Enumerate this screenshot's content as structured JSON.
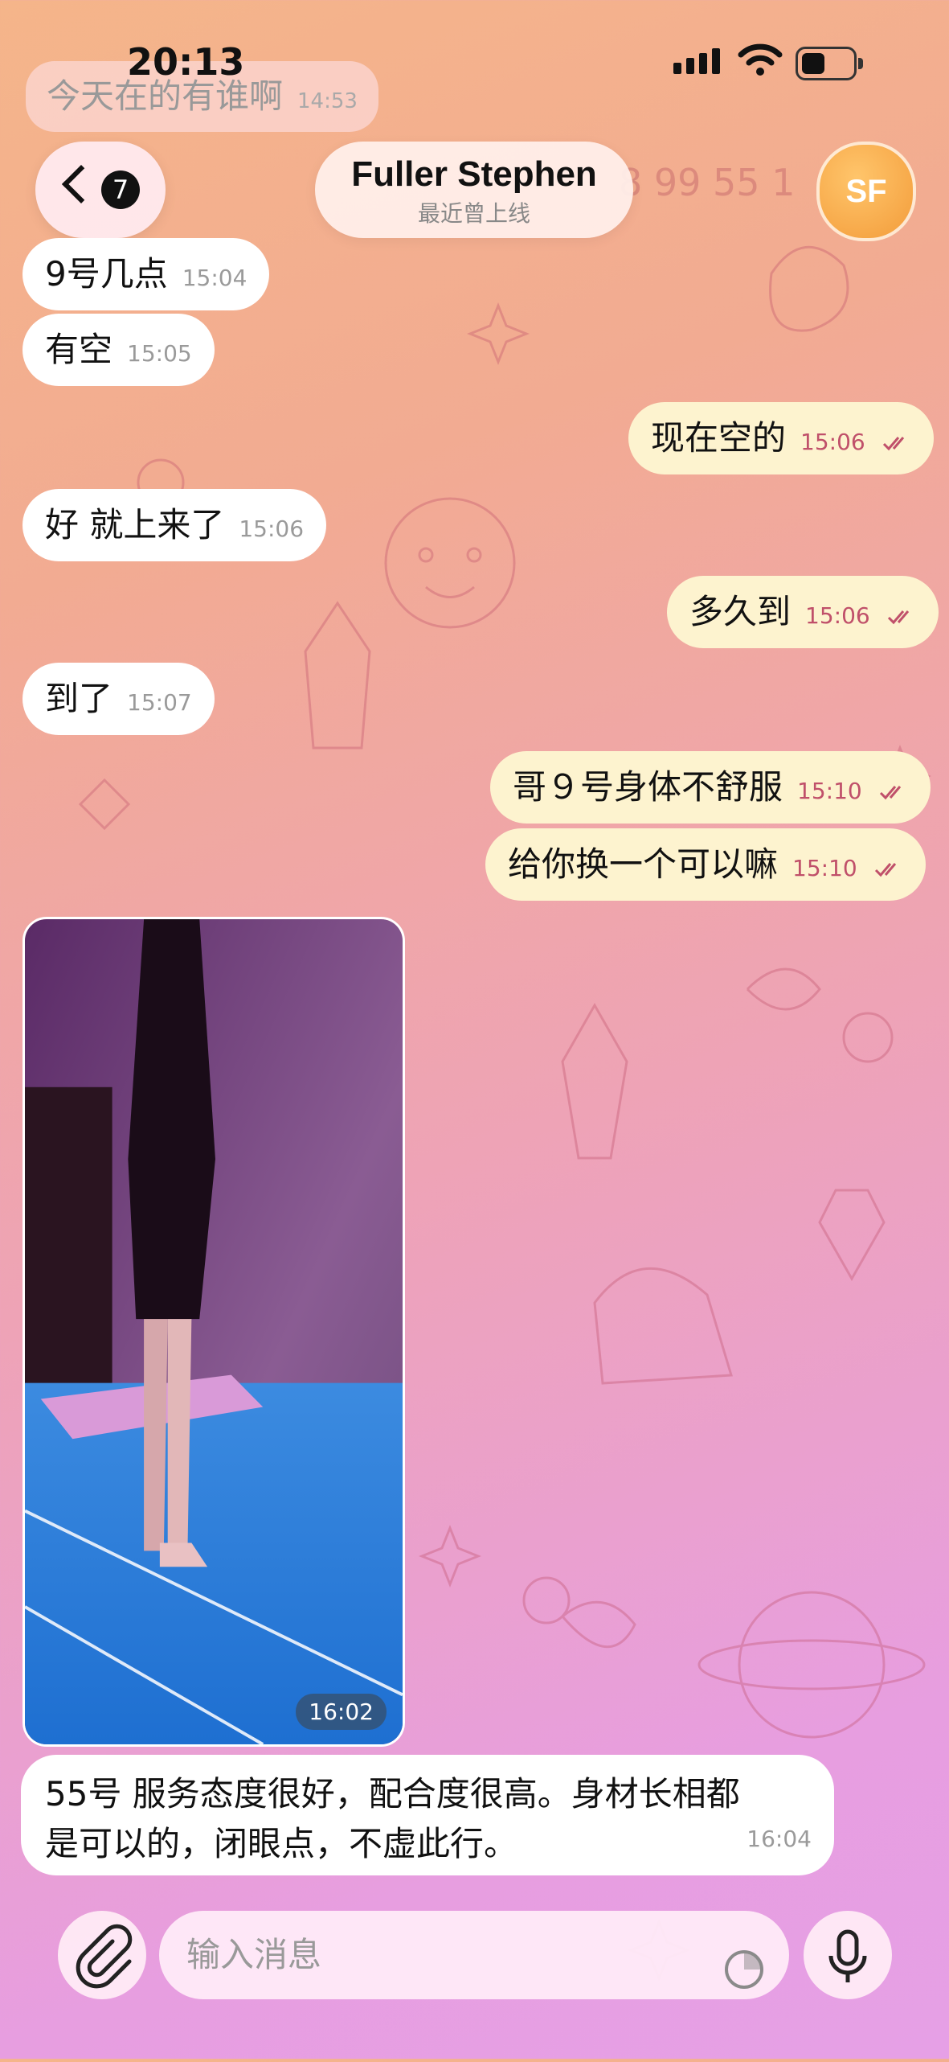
{
  "status_bar": {
    "time": "20:13"
  },
  "faded_top": {
    "text": "今天在的有谁啊",
    "time": "14:53"
  },
  "faded_right": "8 99 55 1",
  "header": {
    "back_badge": "7",
    "contact_name": "Fuller Stephen",
    "contact_status": "最近曾上线",
    "avatar_initials": "SF"
  },
  "messages": [
    {
      "dir": "in",
      "text": "9号几点",
      "time": "15:04"
    },
    {
      "dir": "in",
      "text": "有空",
      "time": "15:05"
    },
    {
      "dir": "out",
      "text": "现在空的",
      "time": "15:06"
    },
    {
      "dir": "in",
      "text": "好 就上来了",
      "time": "15:06"
    },
    {
      "dir": "out",
      "text": "多久到",
      "time": "15:06"
    },
    {
      "dir": "in",
      "text": "到了",
      "time": "15:07"
    },
    {
      "dir": "out",
      "text": "哥９号身体不舒服",
      "time": "15:10"
    },
    {
      "dir": "out",
      "text": "给你换一个可以嘛",
      "time": "15:10"
    }
  ],
  "photo": {
    "time": "16:02"
  },
  "long_message": {
    "line1": "55号 服务态度很好，配合度很高。身材长相都",
    "line2": "是可以的，闭眼点，不虚此行。",
    "time": "16:04"
  },
  "input": {
    "placeholder": "输入消息"
  },
  "colors": {
    "accent": "#c0506a",
    "outgoing_bubble": "#fdf3cf",
    "incoming_bubble": "#ffffff"
  }
}
